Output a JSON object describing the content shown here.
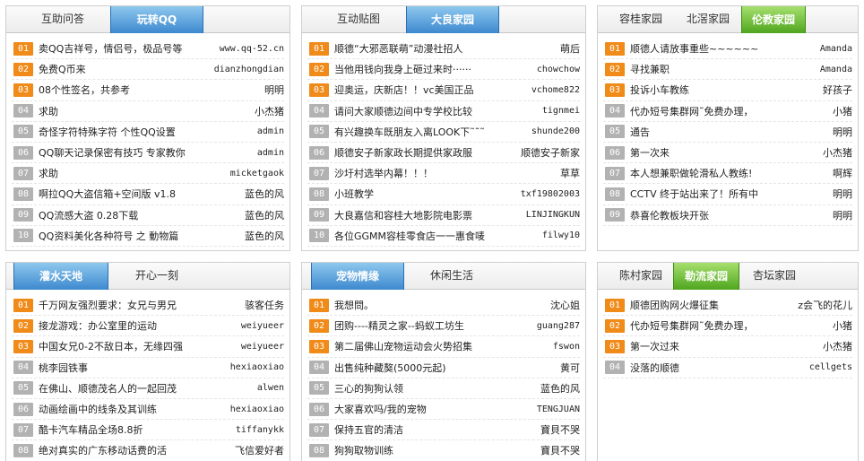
{
  "panels": [
    {
      "tabs": [
        {
          "label": "互助问答",
          "active": false
        },
        {
          "label": "玩转QQ",
          "active": true,
          "color": "blue"
        }
      ],
      "rows": [
        {
          "num": "01",
          "title": "卖QQ吉祥号，情侣号，极品号等",
          "author": "www.qq-52.cn"
        },
        {
          "num": "02",
          "title": "免费Q币来",
          "author": "dianzhongdian"
        },
        {
          "num": "03",
          "title": "08个性签名，共参考",
          "author": "明明"
        },
        {
          "num": "04",
          "title": "求助",
          "author": "小杰猪"
        },
        {
          "num": "05",
          "title": "奇怪字符特殊字符 个性QQ设置",
          "author": "admin"
        },
        {
          "num": "06",
          "title": "QQ聊天记录保密有技巧 专家教你",
          "author": "admin"
        },
        {
          "num": "07",
          "title": "求助",
          "author": "micketgaok"
        },
        {
          "num": "08",
          "title": "啊拉QQ大盗信箱+空间版 v1.8",
          "author": "蓝色的风"
        },
        {
          "num": "09",
          "title": "QQ流感大盗 0.28下载",
          "author": "蓝色的风"
        },
        {
          "num": "10",
          "title": "QQ资料美化各种符号 之 動物篇",
          "author": "蓝色的风"
        }
      ]
    },
    {
      "tabs": [
        {
          "label": "互动贴图",
          "active": false
        },
        {
          "label": "大良家园",
          "active": true,
          "color": "blue"
        }
      ],
      "rows": [
        {
          "num": "01",
          "title": "顺德“大邪恶联萌”动漫社招人",
          "author": "萌后"
        },
        {
          "num": "02",
          "title": "当他用钱向我身上砸过来时······",
          "author": "chowchow"
        },
        {
          "num": "03",
          "title": "迎奥运，庆新店！！vc美国正品",
          "author": "vchome822"
        },
        {
          "num": "04",
          "title": "请问大家顺德边间中专学校比较",
          "author": "tignmei"
        },
        {
          "num": "05",
          "title": "有兴趣换车既朋友入离LOOK下˜˜˜",
          "author": "shunde200"
        },
        {
          "num": "06",
          "title": "顺德安子新家政长期提供家政服",
          "author": "顺德安子新家"
        },
        {
          "num": "07",
          "title": "沙圩村选举内幕！！！",
          "author": "草草"
        },
        {
          "num": "08",
          "title": "小班教学",
          "author": "txf19802003"
        },
        {
          "num": "09",
          "title": "大良嘉信和容桂大地影院电影票",
          "author": "LINJINGKUN"
        },
        {
          "num": "10",
          "title": "各位GGMM容桂零食店一一惠食唛",
          "author": "filwy10"
        }
      ]
    },
    {
      "tabs": [
        {
          "label": "容桂家园",
          "active": false
        },
        {
          "label": "北滘家园",
          "active": false
        },
        {
          "label": "伦教家园",
          "active": true,
          "color": "green"
        }
      ],
      "rows": [
        {
          "num": "01",
          "title": "顺德人请放事重些~~~~~~",
          "author": "Amanda"
        },
        {
          "num": "02",
          "title": "寻找兼职",
          "author": "Amanda"
        },
        {
          "num": "03",
          "title": "投诉小车教练",
          "author": "好孩子"
        },
        {
          "num": "04",
          "title": "代办短号集群网˜免费办理，",
          "author": "小猪"
        },
        {
          "num": "05",
          "title": "通告",
          "author": "明明"
        },
        {
          "num": "06",
          "title": "第一次来",
          "author": "小杰猪"
        },
        {
          "num": "07",
          "title": "本人想兼职做轮滑私人教练!",
          "author": "啊辉"
        },
        {
          "num": "08",
          "title": "CCTV 终于站出来了！所有中",
          "author": "明明"
        },
        {
          "num": "09",
          "title": "恭喜伦教板块开张",
          "author": "明明"
        }
      ]
    },
    {
      "tabs": [
        {
          "label": "灌水天地",
          "active": true,
          "color": "blue"
        },
        {
          "label": "开心一刻",
          "active": false
        }
      ],
      "rows": [
        {
          "num": "01",
          "title": "千万网友强烈要求：女兄与男兄",
          "author": "骇客任务"
        },
        {
          "num": "02",
          "title": "接龙游戏：办公室里的运动",
          "author": "weiyueer"
        },
        {
          "num": "03",
          "title": "中国女兄0-2不敌日本，无缘四强",
          "author": "weiyueer"
        },
        {
          "num": "04",
          "title": "桃李园铁事",
          "author": "hexiaoxiao"
        },
        {
          "num": "05",
          "title": "在佛山、顺德茂名人的一起回茂",
          "author": "alwen"
        },
        {
          "num": "06",
          "title": "动画绘画中的线条及其训练",
          "author": "hexiaoxiao"
        },
        {
          "num": "07",
          "title": "酷卡汽车精品全场8.8折",
          "author": "tiffanykk"
        },
        {
          "num": "08",
          "title": "绝对真实的广东移动话费的活",
          "author": "飞信爱好者"
        }
      ]
    },
    {
      "tabs": [
        {
          "label": "宠物情缘",
          "active": true,
          "color": "blue"
        },
        {
          "label": "休闲生活",
          "active": false
        }
      ],
      "rows": [
        {
          "num": "01",
          "title": "我想問。",
          "author": "沈心姐"
        },
        {
          "num": "02",
          "title": "团购----精灵之家--蚂蚁工坊生",
          "author": "guang287"
        },
        {
          "num": "03",
          "title": "第二届佛山宠物运动会火势招集",
          "author": "fswon"
        },
        {
          "num": "04",
          "title": "出售纯种藏獒(5000元起)",
          "author": "黄可"
        },
        {
          "num": "05",
          "title": "三心的狗狗认领",
          "author": "蓝色的风"
        },
        {
          "num": "06",
          "title": "大家喜欢吗/我的宠物",
          "author": "TENGJUAN"
        },
        {
          "num": "07",
          "title": "保持五官的清洁",
          "author": "寶貝不哭"
        },
        {
          "num": "08",
          "title": "狗狗取物训练",
          "author": "寶貝不哭"
        }
      ]
    },
    {
      "tabs": [
        {
          "label": "陈村家园",
          "active": false
        },
        {
          "label": "勒流家园",
          "active": true,
          "color": "green"
        },
        {
          "label": "杏坛家园",
          "active": false
        }
      ],
      "rows": [
        {
          "num": "01",
          "title": "顺德团购网火爆征集",
          "author": "z会飞的花儿"
        },
        {
          "num": "02",
          "title": "代办短号集群网˜免费办理，",
          "author": "小猪"
        },
        {
          "num": "03",
          "title": "第一次过来",
          "author": "小杰猪"
        },
        {
          "num": "04",
          "title": "没落的顺德",
          "author": "cellgets"
        }
      ]
    }
  ],
  "colors": {
    "hot": "#f08a18",
    "norm": "#b2b2b2",
    "tab_blue": "#3d89cf",
    "tab_green": "#4fa51e"
  }
}
